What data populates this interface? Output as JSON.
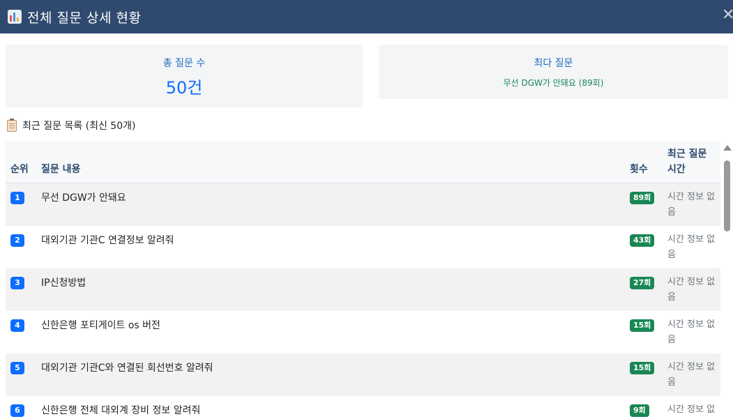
{
  "header": {
    "title": "전체 질문 상세 현황",
    "icon": "bar-chart-icon",
    "close_symbol": "✕"
  },
  "summary": {
    "total_label": "총 질문 수",
    "total_value": "50건",
    "top_label": "최다 질문",
    "top_value": "무선 DGW가 안돼요 (89회)"
  },
  "list": {
    "title": "최근 질문 목록 (최신 50개)",
    "icon": "clipboard-icon",
    "columns": {
      "rank": "순위",
      "question": "질문 내용",
      "count": "횟수",
      "time": "최근 질문 시간"
    },
    "rows": [
      {
        "rank": "1",
        "question": "무선 DGW가 안돼요",
        "count": "89회",
        "time": "시간 정보 없음"
      },
      {
        "rank": "2",
        "question": "대외기관 기관C 연결정보 알려줘",
        "count": "43회",
        "time": "시간 정보 없음"
      },
      {
        "rank": "3",
        "question": "IP신청방법",
        "count": "27회",
        "time": "시간 정보 없음"
      },
      {
        "rank": "4",
        "question": "신한은행 포티게이트 os 버전",
        "count": "15회",
        "time": "시간 정보 없음"
      },
      {
        "rank": "5",
        "question": "대외기관 기관C와 연결된 회선번호 알려줘",
        "count": "15회",
        "time": "시간 정보 없음"
      },
      {
        "rank": "6",
        "question": "신한은행 전체 대외계 장비 정보 알려줘",
        "count": "9회",
        "time": "시간 정보 없음"
      }
    ]
  },
  "colors": {
    "header_bg": "#2f4a6e",
    "rank_badge": "#0d6efd",
    "count_badge": "#198754",
    "summary_label": "#1f6fbf"
  }
}
